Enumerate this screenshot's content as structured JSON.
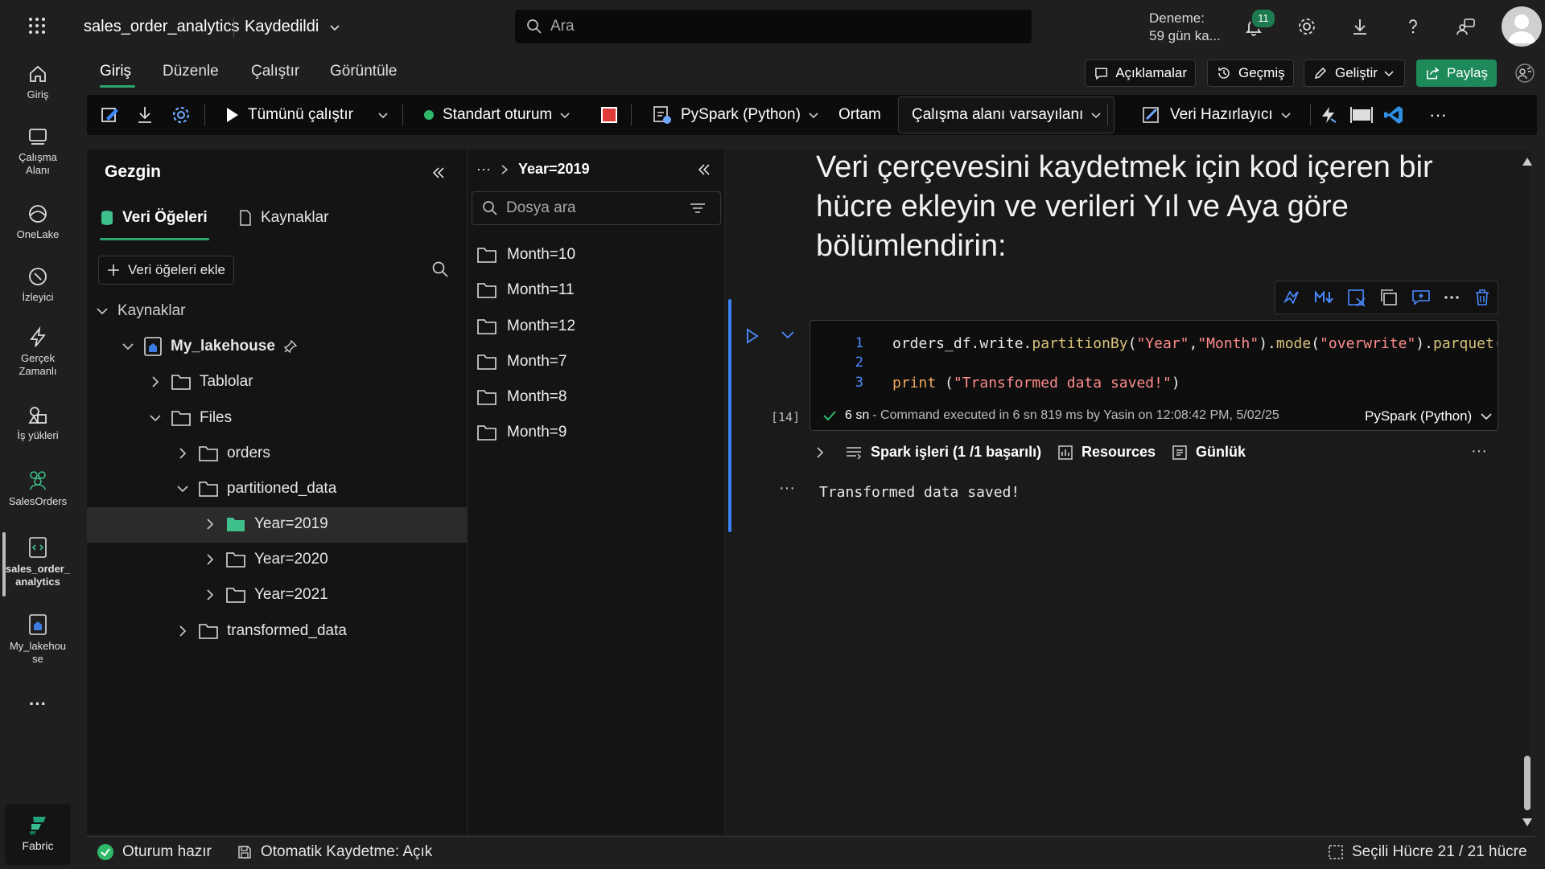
{
  "app": {
    "notebook_name": "sales_order_analytics",
    "save_state": "Kaydedildi",
    "search_placeholder": "Ara",
    "trial_line1": "Deneme:",
    "trial_line2": "59 gün ka...",
    "notification_count": "11"
  },
  "rail": {
    "items": [
      {
        "label": "Giriş"
      },
      {
        "label": "Çalışma Alanı"
      },
      {
        "label": "OneLake"
      },
      {
        "label": "İzleyici"
      },
      {
        "label": "Gerçek Zamanlı"
      },
      {
        "label": "İş yükleri"
      },
      {
        "label": "SalesOrders"
      },
      {
        "label": "sales_order_ analytics"
      },
      {
        "label": "My_lakehou se"
      }
    ],
    "more": "···",
    "fabric_label": "Fabric"
  },
  "menu": {
    "tabs": [
      {
        "label": "Giriş"
      },
      {
        "label": "Düzenle"
      },
      {
        "label": "Çalıştır"
      },
      {
        "label": "Görüntüle"
      }
    ],
    "comments": "Açıklamalar",
    "history": "Geçmiş",
    "develop": "Geliştir",
    "share": "Paylaş"
  },
  "toolbar": {
    "run_all": "Tümünü çalıştır",
    "session": "Standart oturum",
    "language": "PySpark (Python)",
    "environment_label": "Ortam",
    "environment_value": "Çalışma alanı varsayılanı",
    "data_wrangler": "Veri Hazırlayıcı",
    "more": "···"
  },
  "explorer": {
    "title": "Gezgin",
    "tab_data_items": "Veri Öğeleri",
    "tab_resources": "Kaynaklar",
    "add_data_items": "Veri öğeleri ekle",
    "section": "Kaynaklar",
    "lakehouse": "My_lakehouse",
    "tables": "Tablolar",
    "files": "Files",
    "orders": "orders",
    "partitioned": "partitioned_data",
    "years": [
      {
        "label": "Year=2019"
      },
      {
        "label": "Year=2020"
      },
      {
        "label": "Year=2021"
      }
    ],
    "transformed": "transformed_data"
  },
  "filepane": {
    "breadcrumb_more": "···",
    "breadcrumb_current": "Year=2019",
    "search_placeholder": "Dosya ara",
    "folders": [
      {
        "label": "Month=10"
      },
      {
        "label": "Month=11"
      },
      {
        "label": "Month=12"
      },
      {
        "label": "Month=7"
      },
      {
        "label": "Month=8"
      },
      {
        "label": "Month=9"
      }
    ]
  },
  "notebook": {
    "markdown": "Veri çerçevesini kaydetmek için kod içeren bir hücre ekleyin ve verileri Yıl ve Aya göre bölümlendirin:",
    "cell_number": "[14]",
    "code": {
      "l1_num": "1",
      "l2_num": "2",
      "l3_num": "3",
      "l1_a": "orders_df.write.",
      "l1_fn": "partitionBy",
      "l1_b": "(",
      "l1_s1": "\"Year\"",
      "l1_c": ",",
      "l1_s2": "\"Month\"",
      "l1_d": ").",
      "l1_fn2": "mode",
      "l1_e": "(",
      "l1_s3": "\"overwrite\"",
      "l1_f": ").",
      "l1_fn3": "parquet",
      "l1_g": "(\"",
      "l3_kw": "print",
      "l3_a": " (",
      "l3_s": "\"Transformed data saved!\"",
      "l3_b": ")"
    },
    "exec_time": "6 sn",
    "exec_detail": "- Command executed in 6 sn 819 ms by Yasin on 12:08:42 PM, 5/02/25",
    "cell_language": "PySpark (Python)",
    "spark_jobs": "Spark işleri (1 /1 başarılı)",
    "resources": "Resources",
    "log": "Günlük",
    "output": "Transformed data saved!",
    "output_more": "···"
  },
  "statusbar": {
    "session": "Oturum hazır",
    "autosave": "Otomatik Kaydetme: Açık",
    "selection": "Seçili Hücre 21 / 21 hücre"
  }
}
